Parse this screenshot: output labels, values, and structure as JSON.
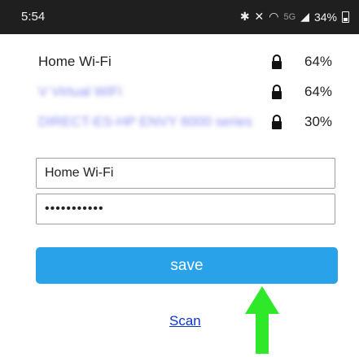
{
  "status_bar": {
    "time": "5:54",
    "icons": [
      "bluetooth-icon",
      "mute-vibrate-icon",
      "wifi-icon",
      "signal-icon",
      "battery-icon"
    ],
    "network_type": "5G",
    "battery_percent": "34%"
  },
  "networks": [
    {
      "name": "Home Wi-Fi",
      "signal": "64%",
      "secured": true,
      "obscured": false
    },
    {
      "name": "V Virtual WiFi",
      "signal": "64%",
      "secured": true,
      "obscured": true
    },
    {
      "name": "DIRECT-ES-HP ENVY 6000 series",
      "signal": "30%",
      "secured": true,
      "obscured": true
    }
  ],
  "form": {
    "ssid_value": "Home Wi-Fi",
    "password_value": "•••••••••••"
  },
  "buttons": {
    "save_label": "save",
    "scan_label": "Scan"
  },
  "colors": {
    "accent": "#2aa2ea",
    "link": "#1034c7",
    "annotation_arrow": "#2ee829",
    "status_bar_bg": "#1f1f1f"
  }
}
